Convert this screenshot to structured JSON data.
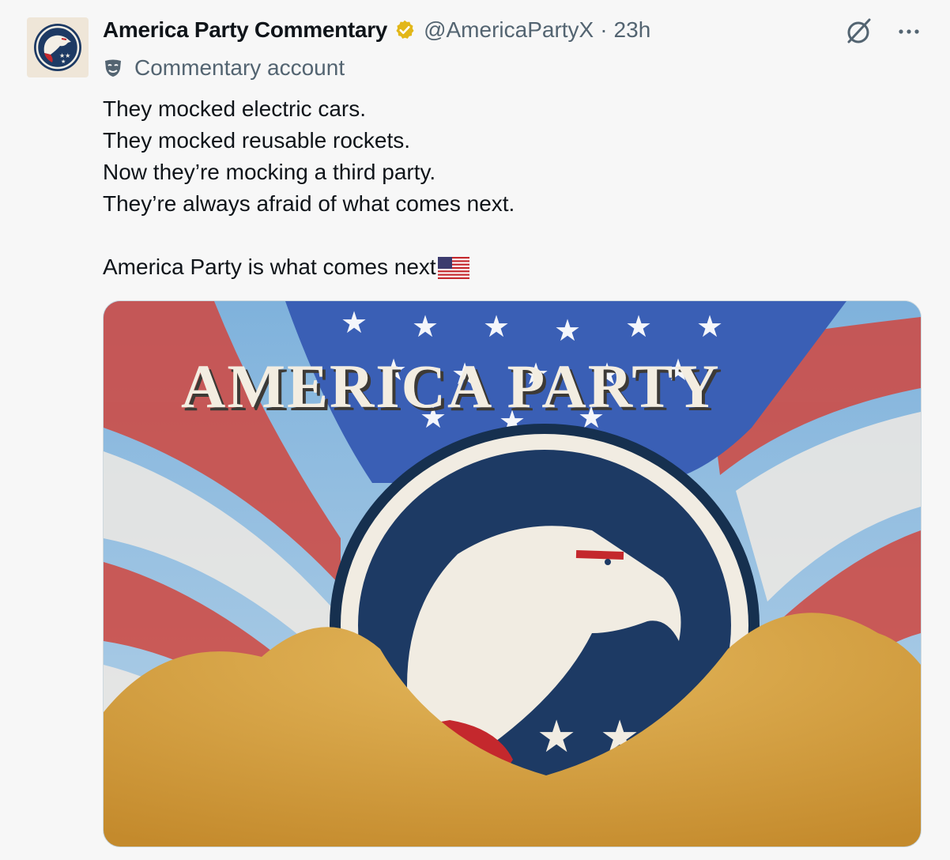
{
  "post": {
    "author_name": "America Party Commentary",
    "handle": "@AmericaPartyX",
    "separator": "·",
    "time": "23h",
    "label": "Commentary account",
    "lines": [
      "They mocked electric cars.",
      "They mocked reusable rockets.",
      "Now they’re mocking a third party.",
      "They’re always afraid of what comes next."
    ],
    "closing_line": "America Party is what comes next",
    "media": {
      "headline": "AMERICA PARTY"
    }
  },
  "icons": {
    "avatar": "eagle-logo-icon",
    "verified": "verified-badge-icon",
    "grok": "grok-icon",
    "more": "more-icon",
    "label": "mask-icon",
    "flag": "us-flag-icon"
  },
  "colors": {
    "background": "#f7f7f7",
    "text": "#0f1419",
    "muted": "#536471",
    "badge": "#e2b719",
    "navy": "#1d3a64",
    "red": "#c4282d"
  }
}
